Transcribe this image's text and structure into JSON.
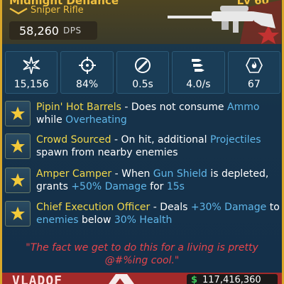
{
  "item": {
    "name": "Midnight Defiance",
    "level": "Lv 60",
    "type": "Sniper Rifle",
    "dps_value": "58,260",
    "dps_label": "DPS",
    "rarity": "legendary"
  },
  "stats": [
    {
      "icon": "damage-burst-icon",
      "value": "15,156"
    },
    {
      "icon": "crosshair-icon",
      "value": "84%"
    },
    {
      "icon": "reload-icon",
      "value": "0.5s"
    },
    {
      "icon": "fire-rate-icon",
      "value": "4.0/s"
    },
    {
      "icon": "magazine-flame-icon",
      "value": "67"
    }
  ],
  "perks": [
    {
      "name": "Pipin' Hot Barrels",
      "t1": " - Does not consume ",
      "k1": "Ammo",
      "t2": " while ",
      "k2": "Overheating",
      "t3": "",
      "k3": "",
      "t4": "",
      "k4": "",
      "t5": ""
    },
    {
      "name": "Crowd Sourced",
      "t1": " - On hit, additional ",
      "k1": "Projectiles",
      "t2": " spawn from nearby enemies",
      "k2": "",
      "t3": "",
      "k3": "",
      "t4": "",
      "k4": "",
      "t5": ""
    },
    {
      "name": "Amper Camper",
      "t1": " - When ",
      "k1": "Gun Shield",
      "t2": " is depleted, grants ",
      "k2": "+50% Damage",
      "t3": " for ",
      "k3": "15s",
      "t4": "",
      "k4": "",
      "t5": ""
    },
    {
      "name": "Chief Execution Officer",
      "t1": " - Deals ",
      "k1": "+30% Damage",
      "t2": " to ",
      "k2": "enemies",
      "t3": " below ",
      "k3": "30% Health",
      "t4": "",
      "k4": "",
      "t5": ""
    }
  ],
  "quote": "\"The fact we get to do this for a living is pretty @#%ing cool.\"",
  "footer": {
    "manufacturer": "VLADOF",
    "price_symbol": "$",
    "price": "117,416,360"
  },
  "colors": {
    "frame_gold": "#d9a72a",
    "perk_name": "#f2d84a",
    "keyword_blue": "#5fb7ea",
    "quote_red": "#e8454b",
    "footer_red": "#a32a2a"
  }
}
